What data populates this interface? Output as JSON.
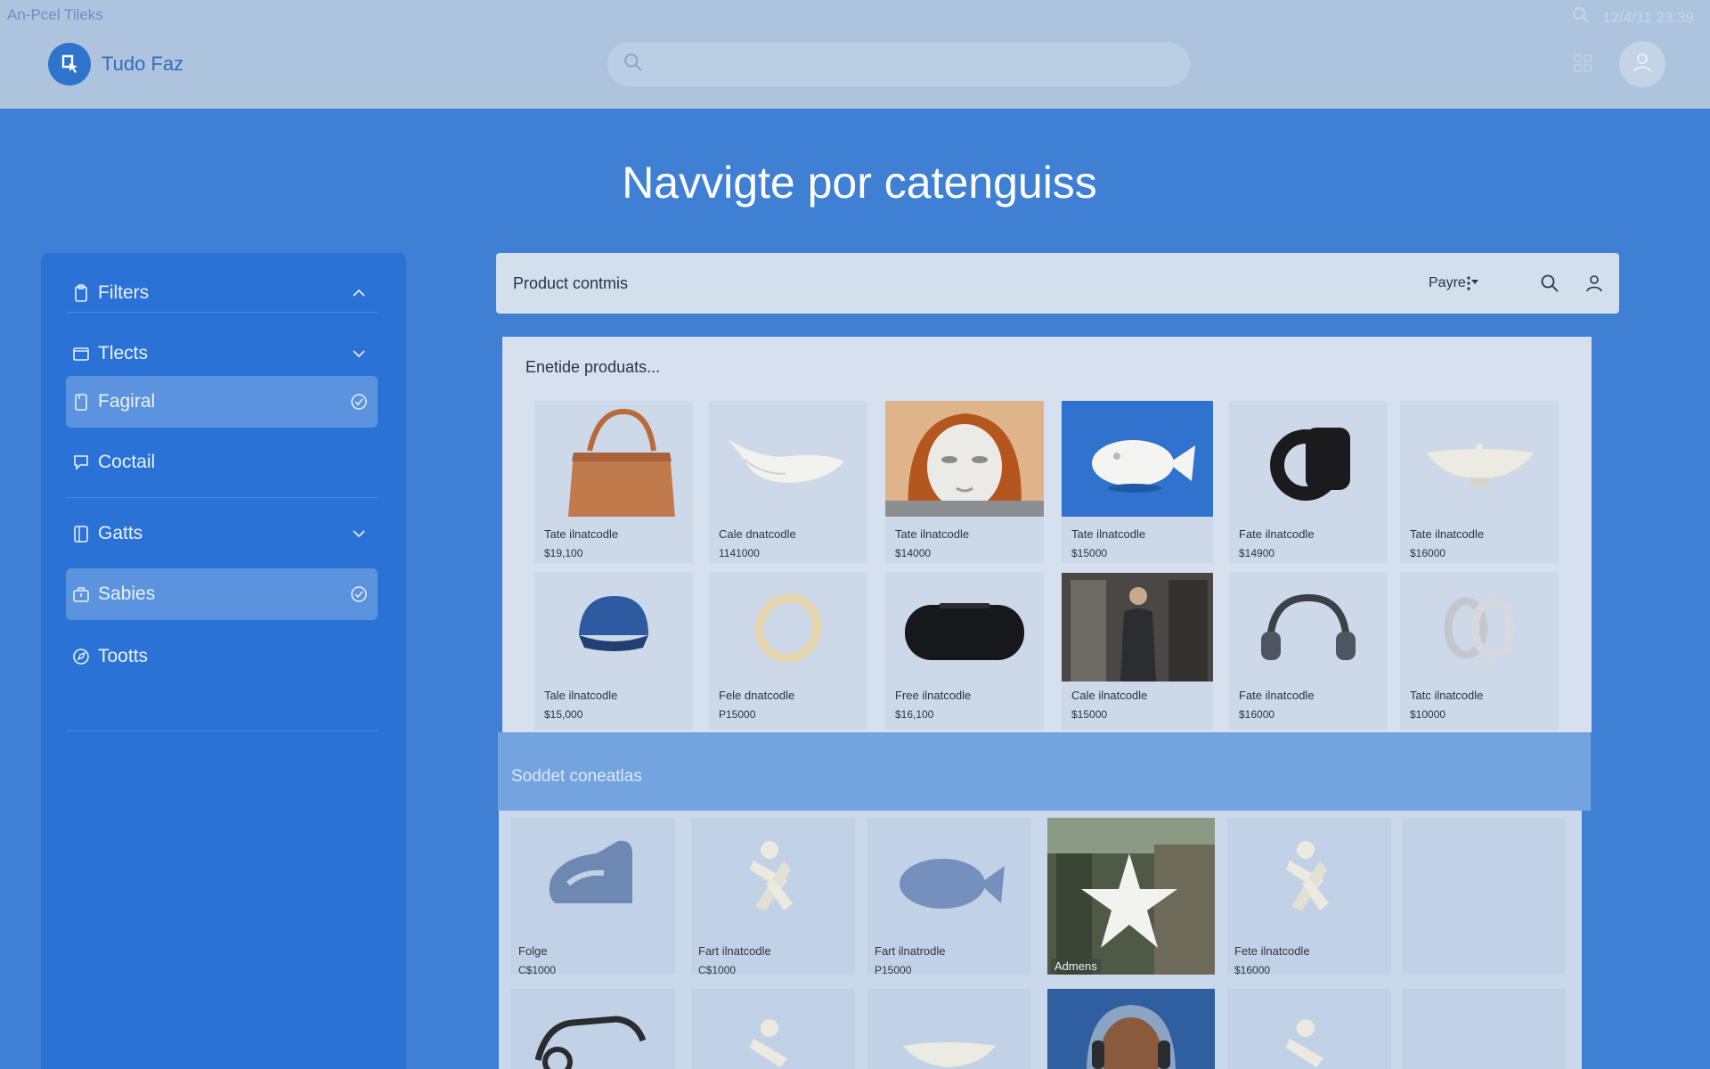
{
  "system": {
    "app_label": "An-Pcel Tileks",
    "clock": "12/4/11 23:39",
    "search_icon": "search-icon"
  },
  "header": {
    "brand": "Tudo Faz",
    "search_placeholder": "",
    "grid_icon": "grid-icon",
    "avatar_icon": "user-icon"
  },
  "page": {
    "title": "Navvigte por catenguiss"
  },
  "sidebar": {
    "items": [
      {
        "label": "Filters",
        "icon": "clipboard-icon",
        "trail": "chevron-up-icon",
        "active": false
      },
      {
        "label": "Tlects",
        "icon": "folder-icon",
        "trail": "chevron-down-icon",
        "active": false
      },
      {
        "label": "Fagiral",
        "icon": "document-icon",
        "trail": "check-circle-icon",
        "active": true
      },
      {
        "label": "Coctail",
        "icon": "chat-icon",
        "trail": "",
        "active": false
      },
      {
        "label": "Gatts",
        "icon": "book-icon",
        "trail": "chevron-down-icon",
        "active": false
      },
      {
        "label": "Sabies",
        "icon": "briefcase-icon",
        "trail": "check-circle-icon",
        "active": true
      },
      {
        "label": "Tootts",
        "icon": "compass-icon",
        "trail": "",
        "active": false
      }
    ]
  },
  "toolbar": {
    "title": "Product contmis",
    "sort_label": "Payre",
    "more_icon": "more-vertical-icon",
    "search_icon": "search-icon",
    "user_icon": "user-icon"
  },
  "products": {
    "title": "Enetide produats...",
    "items": [
      {
        "name": "Tate ilnatcodle",
        "price": "$19,100",
        "image": "handbag"
      },
      {
        "name": "Cale dnatcodle",
        "price": "1141000",
        "image": "gravy-boat"
      },
      {
        "name": "Tate ilnatcodle",
        "price": "$14000",
        "image": "mask-face"
      },
      {
        "name": "Tate ilnatcodle",
        "price": "$15000",
        "image": "ceramic-fish"
      },
      {
        "name": "Fate ilnatcodle",
        "price": "$14900",
        "image": "black-camera-strap"
      },
      {
        "name": "Tate ilnatcodle",
        "price": "$16000",
        "image": "white-dish"
      },
      {
        "name": "Tale ilnatcodle",
        "price": "$15,000",
        "image": "blue-cap"
      },
      {
        "name": "Fele dnatcodle",
        "price": "P15000",
        "image": "gold-ring"
      },
      {
        "name": "Free ilnatcodle",
        "price": "$16,100",
        "image": "speaker"
      },
      {
        "name": "Cale ilnatcodle",
        "price": "$15000",
        "image": "person-photo"
      },
      {
        "name": "Fate ilnatcodle",
        "price": "$16000",
        "image": "headphones"
      },
      {
        "name": "Tatc ilnatcodle",
        "price": "$10000",
        "image": "silver-rings"
      }
    ]
  },
  "similar": {
    "title": "Soddet coneatlas",
    "items": [
      {
        "name": "Folge",
        "price": "C$1000",
        "image": "blue-shoe"
      },
      {
        "name": "Fart ilnatcodle",
        "price": "C$1000",
        "image": "white-figure"
      },
      {
        "name": "Fart ilnatrodle",
        "price": "P15000",
        "image": "blue-fish"
      },
      {
        "name": "",
        "price": "",
        "overlay": "Admens",
        "image": "temple-photo"
      },
      {
        "name": "Fete ilnatcodle",
        "price": "$16000",
        "image": "white-figure"
      },
      {
        "name": "",
        "price": "",
        "image": "empty"
      }
    ]
  }
}
